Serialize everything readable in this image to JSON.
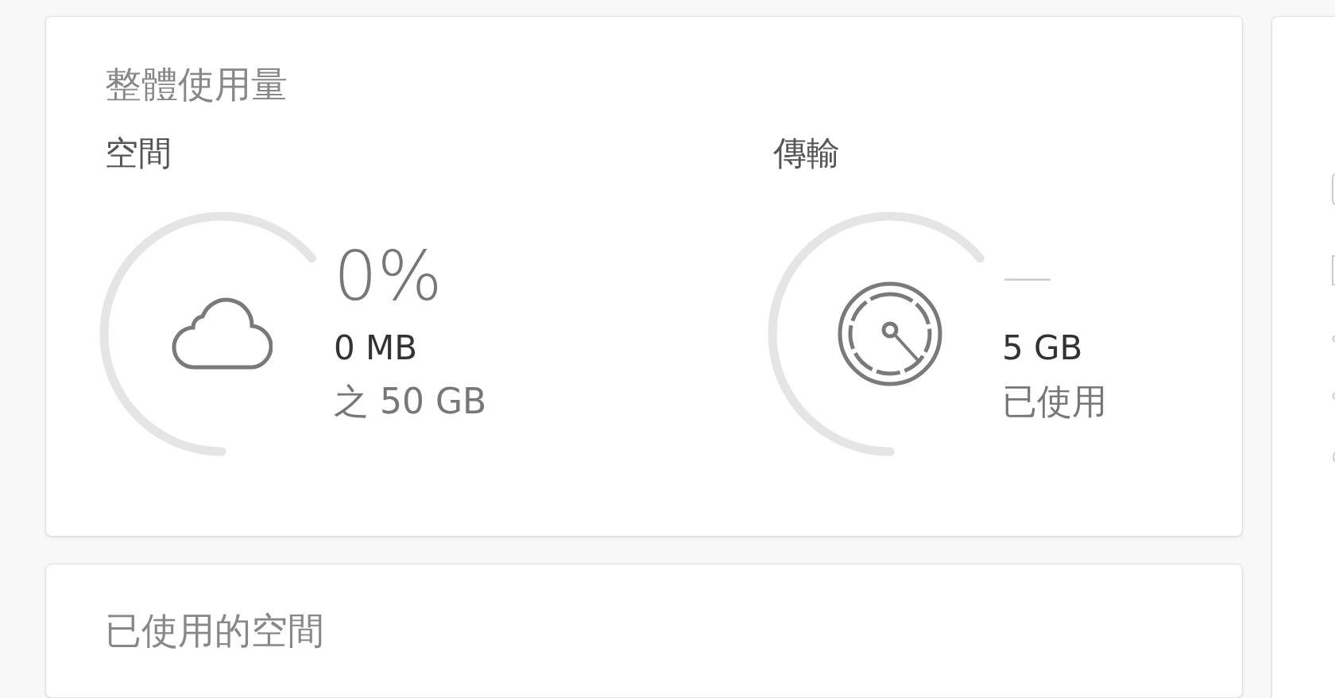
{
  "usage_card": {
    "title": "整體使用量",
    "sections": [
      {
        "kind": "storage",
        "heading": "空間",
        "level": 0,
        "primary": "0%",
        "value": "0 MB",
        "caption": "之 50 GB"
      },
      {
        "kind": "transfer",
        "heading": "傳輸",
        "level": 0,
        "primary": "—",
        "value": "5 GB",
        "caption": "已使用"
      }
    ]
  },
  "used_space_card": {
    "title": "已使用的空間"
  }
}
